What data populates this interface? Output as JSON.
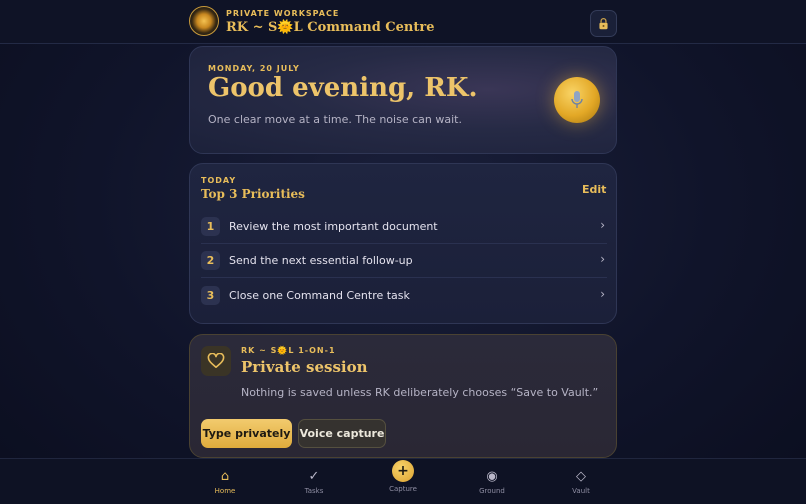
{
  "header": {
    "eyebrow": "PRIVATE WORKSPACE",
    "title": "RK ~ S🌞L Command Centre"
  },
  "hero": {
    "date": "MONDAY, 20 JULY",
    "greeting": "Good evening, RK.",
    "subtitle": "One clear move at a time. The noise can wait."
  },
  "priorities": {
    "eyebrow": "TODAY",
    "title": "Top 3 Priorities",
    "edit_label": "Edit",
    "items": [
      {
        "num": "1",
        "text": "Review the most important document"
      },
      {
        "num": "2",
        "text": "Send the next essential follow-up"
      },
      {
        "num": "3",
        "text": "Close one Command Centre task"
      }
    ]
  },
  "session": {
    "eyebrow": "RK ~ S🌞L 1-ON-1",
    "title": "Private session",
    "subtitle": "Nothing is saved unless RK deliberately chooses “Save to Vault.”",
    "primary_button": "Type privately",
    "secondary_button": "Voice capture"
  },
  "nav": {
    "items": [
      {
        "label": "Home",
        "icon": "⌂"
      },
      {
        "label": "Tasks",
        "icon": "✓"
      },
      {
        "label": "Capture",
        "icon": "+"
      },
      {
        "label": "Ground",
        "icon": "◉"
      },
      {
        "label": "Vault",
        "icon": "◇"
      }
    ]
  },
  "colors": {
    "accent": "#e8bd5a",
    "background": "#10142a",
    "card": "#1f2540"
  },
  "icons": [
    "sun-logo-icon",
    "lock-icon",
    "microphone-icon",
    "chevron-right-icon",
    "heart-icon",
    "home-icon",
    "check-icon",
    "plus-icon",
    "ground-icon",
    "vault-icon"
  ]
}
